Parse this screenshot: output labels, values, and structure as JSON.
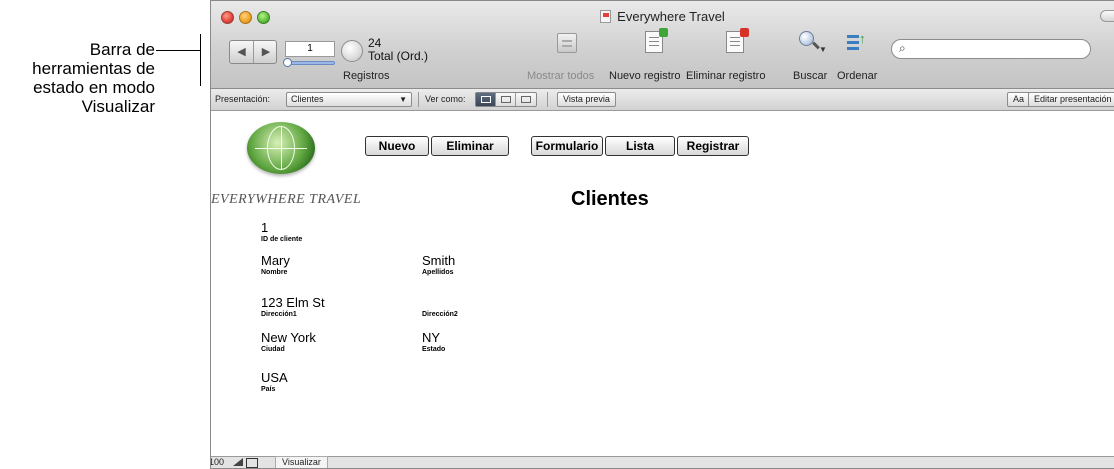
{
  "callout": {
    "text": "Barra de\nherramientas de\nestado en modo\nVisualizar"
  },
  "window": {
    "title": "Everywhere Travel"
  },
  "toolbar": {
    "record_current": "1",
    "record_total": "24",
    "record_total_label": "Total (Ord.)",
    "records_label": "Registros",
    "show_all": "Mostrar todos",
    "new_record": "Nuevo registro",
    "delete_record": "Eliminar registro",
    "find": "Buscar",
    "sort": "Ordenar",
    "search_value": ""
  },
  "layoutbar": {
    "layout_label": "Presentación:",
    "layout_value": "Clientes",
    "view_as": "Ver como:",
    "preview": "Vista previa",
    "aa": "Aa",
    "edit_layout": "Editar presentación"
  },
  "content": {
    "brand": "EVERYWHERE TRAVEL",
    "title": "Clientes",
    "buttons": {
      "new": "Nuevo",
      "delete": "Eliminar",
      "form": "Formulario",
      "list": "Lista",
      "register": "Registrar"
    },
    "fields": {
      "id_value": "1",
      "id_label": "ID de cliente",
      "first_value": "Mary",
      "first_label": "Nombre",
      "last_value": "Smith",
      "last_label": "Apellidos",
      "addr1_value": "123 Elm St",
      "addr1_label": "Dirección1",
      "addr2_value": "",
      "addr2_label": "Dirección2",
      "city_value": "New York",
      "city_label": "Ciudad",
      "state_value": "NY",
      "state_label": "Estado",
      "country_value": "USA",
      "country_label": "País"
    }
  },
  "statusbar": {
    "zoom": "100",
    "mode": "Visualizar"
  }
}
